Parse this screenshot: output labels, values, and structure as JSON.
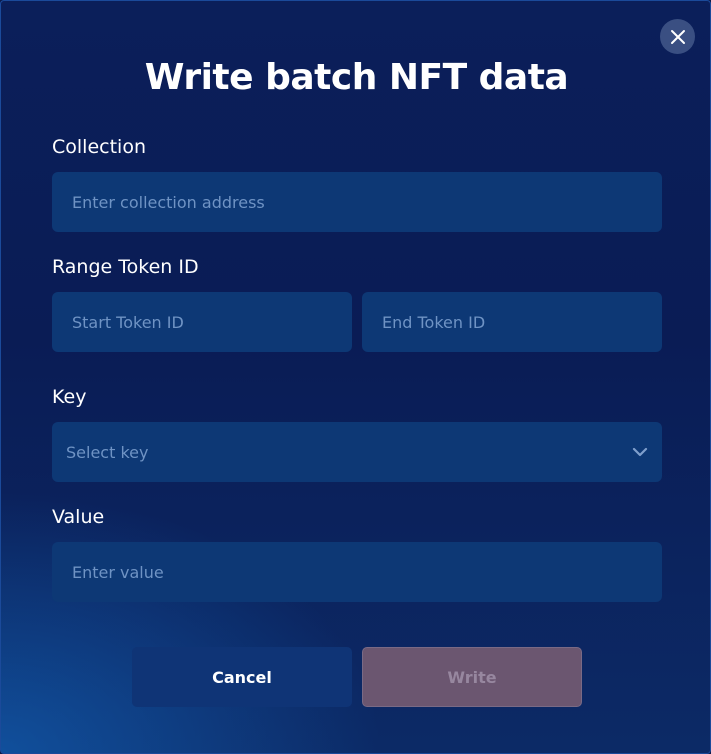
{
  "modal": {
    "title": "Write batch NFT data",
    "close_icon": "close-icon"
  },
  "collection": {
    "label": "Collection",
    "placeholder": "Enter collection address",
    "value": ""
  },
  "range_token_id": {
    "label": "Range Token ID",
    "start_placeholder": "Start Token ID",
    "start_value": "",
    "end_placeholder": "End Token ID",
    "end_value": ""
  },
  "key": {
    "label": "Key",
    "selected": "Select key",
    "icon": "chevron-down-icon"
  },
  "value_field": {
    "label": "Value",
    "placeholder": "Enter value",
    "value": ""
  },
  "actions": {
    "cancel_label": "Cancel",
    "write_label": "Write",
    "write_disabled": true
  },
  "colors": {
    "background": "#0b1f5a",
    "input_bg": "#0d3875",
    "placeholder": "#6f93c4",
    "cancel_bg": "#0f3476",
    "write_disabled_bg": "#6b5670"
  }
}
